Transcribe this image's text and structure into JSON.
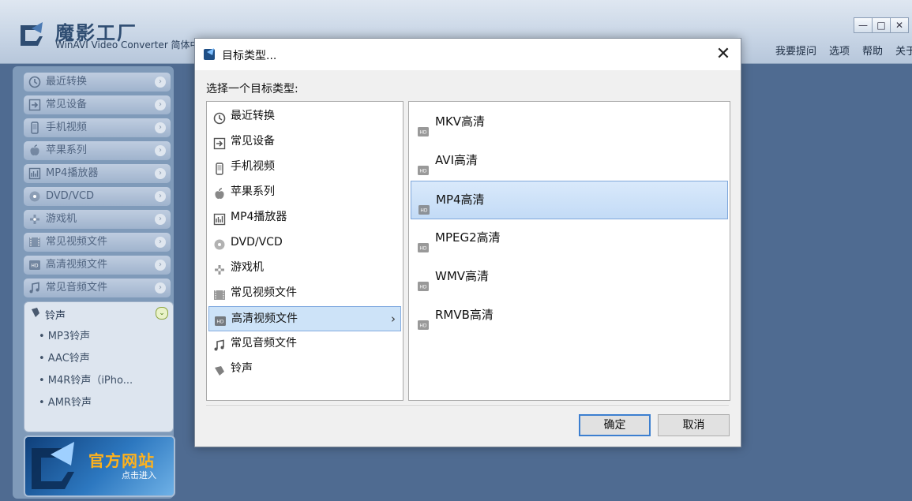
{
  "app": {
    "title": "魔影工厂",
    "subtitle": "WinAVI Video Converter 简体中文",
    "menu": [
      "我要提问",
      "选项",
      "帮助",
      "关于"
    ]
  },
  "window_controls": {
    "minimize": "—",
    "maximize": "□",
    "close": "✕"
  },
  "sidebar": {
    "items": [
      {
        "label": "最近转换",
        "icon": "clock-icon"
      },
      {
        "label": "常见设备",
        "icon": "arrow-in-icon"
      },
      {
        "label": "手机视频",
        "icon": "phone-icon"
      },
      {
        "label": "苹果系列",
        "icon": "apple-icon"
      },
      {
        "label": "MP4播放器",
        "icon": "mp4-player-icon"
      },
      {
        "label": "DVD/VCD",
        "icon": "disc-icon"
      },
      {
        "label": "游戏机",
        "icon": "gamepad-icon"
      },
      {
        "label": "常见视频文件",
        "icon": "film-icon"
      },
      {
        "label": "高清视频文件",
        "icon": "hd-icon"
      },
      {
        "label": "常见音频文件",
        "icon": "music-note-icon"
      }
    ],
    "expanded": {
      "label": "铃声",
      "subitems": [
        "• MP3铃声",
        "• AAC铃声",
        "• M4R铃声（iPho...",
        "• AMR铃声"
      ]
    },
    "banner": {
      "title": "官方网站",
      "subtitle": "点击进入"
    }
  },
  "dialog": {
    "title": "目标类型...",
    "prompt": "选择一个目标类型:",
    "left_list": [
      {
        "label": "最近转换",
        "icon": "clock-icon"
      },
      {
        "label": "常见设备",
        "icon": "arrow-in-icon"
      },
      {
        "label": "手机视频",
        "icon": "phone-icon"
      },
      {
        "label": "苹果系列",
        "icon": "apple-icon"
      },
      {
        "label": "MP4播放器",
        "icon": "mp4-player-icon"
      },
      {
        "label": "DVD/VCD",
        "icon": "disc-icon"
      },
      {
        "label": "游戏机",
        "icon": "gamepad-icon"
      },
      {
        "label": "常见视频文件",
        "icon": "film-icon"
      },
      {
        "label": "高清视频文件",
        "icon": "hd-icon",
        "selected": true
      },
      {
        "label": "常见音频文件",
        "icon": "music-note-icon"
      },
      {
        "label": "铃声",
        "icon": "bell-icon"
      }
    ],
    "right_list": [
      {
        "label": "MKV高清"
      },
      {
        "label": "AVI高清"
      },
      {
        "label": "MP4高清",
        "selected": true
      },
      {
        "label": "MPEG2高清"
      },
      {
        "label": "WMV高清"
      },
      {
        "label": "RMVB高清"
      }
    ],
    "ok_label": "确定",
    "cancel_label": "取消"
  }
}
